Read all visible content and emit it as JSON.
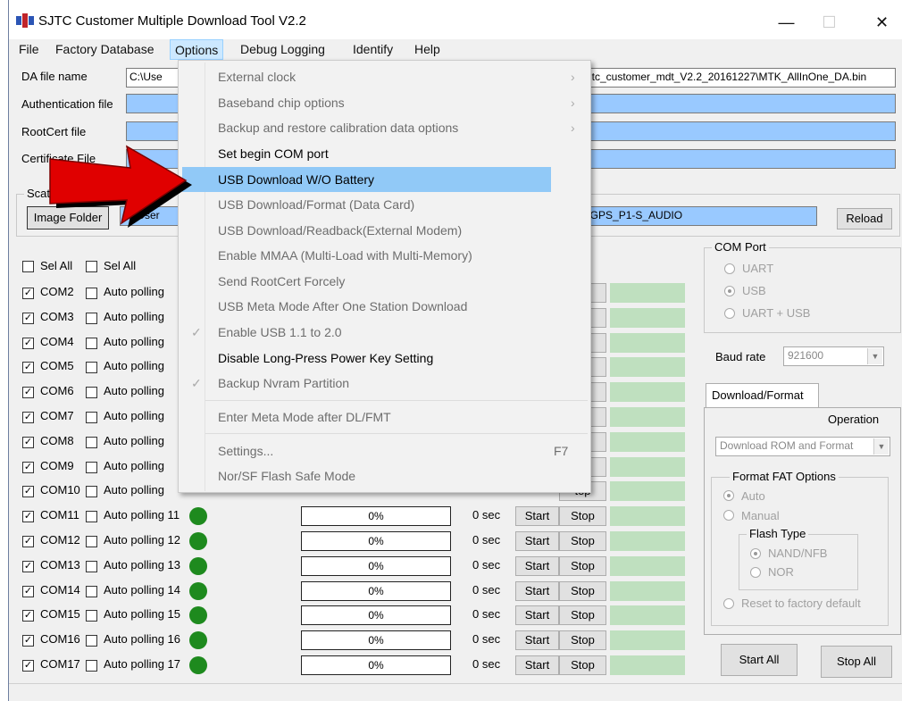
{
  "window": {
    "title": "SJTC Customer Multiple Download Tool V2.2",
    "minimize": "—",
    "maximize": "☐",
    "close": "✕"
  },
  "menubar": [
    "File",
    "Factory Database",
    "Options",
    "Debug Logging",
    "Identify",
    "Help"
  ],
  "files": {
    "da_label": "DA file name",
    "da_value_left": "C:\\Use",
    "da_value_right": "sjtc_customer_mdt_V2.2_20161227\\MTK_AllInOne_DA.bin",
    "auth_label": "Authentication file",
    "rootcert_label": "RootCert file",
    "certificate_label": "Certificate File",
    "scatter_label": "Scatter",
    "image_folder_button": "Image Folder",
    "scatter_value_left": "C:\\User",
    "scatter_value_right": "_GPS_P1-S_AUDIO",
    "reload_button": "Reload"
  },
  "select_all": [
    "Sel All",
    "Sel All"
  ],
  "ports": [
    {
      "name": "COM2",
      "polling": "Auto polling"
    },
    {
      "name": "COM3",
      "polling": "Auto polling"
    },
    {
      "name": "COM4",
      "polling": "Auto polling"
    },
    {
      "name": "COM5",
      "polling": "Auto polling"
    },
    {
      "name": "COM6",
      "polling": "Auto polling"
    },
    {
      "name": "COM7",
      "polling": "Auto polling"
    },
    {
      "name": "COM8",
      "polling": "Auto polling"
    },
    {
      "name": "COM9",
      "polling": "Auto polling"
    },
    {
      "name": "COM10",
      "polling": "Auto polling"
    },
    {
      "name": "COM11",
      "polling": "Auto polling 11",
      "progress": "0%",
      "time": "0 sec"
    },
    {
      "name": "COM12",
      "polling": "Auto polling 12",
      "progress": "0%",
      "time": "0 sec"
    },
    {
      "name": "COM13",
      "polling": "Auto polling 13",
      "progress": "0%",
      "time": "0 sec"
    },
    {
      "name": "COM14",
      "polling": "Auto polling 14",
      "progress": "0%",
      "time": "0 sec"
    },
    {
      "name": "COM15",
      "polling": "Auto polling 15",
      "progress": "0%",
      "time": "0 sec"
    },
    {
      "name": "COM16",
      "polling": "Auto polling 16",
      "progress": "0%",
      "time": "0 sec"
    },
    {
      "name": "COM17",
      "polling": "Auto polling 17",
      "progress": "0%",
      "time": "0 sec"
    }
  ],
  "row_buttons": {
    "start": "Start",
    "stop": "Stop",
    "stop_partial": "top"
  },
  "com_port": {
    "title": "COM Port",
    "options": [
      "UART",
      "USB",
      "UART + USB"
    ],
    "selected": "USB"
  },
  "baud": {
    "label": "Baud rate",
    "value": "921600"
  },
  "download_tab": {
    "tab": "Download/Format",
    "operation_label": "Operation",
    "operation_value": "Download ROM and Format"
  },
  "format_fat": {
    "title": "Format FAT Options",
    "auto": "Auto",
    "manual": "Manual",
    "flash_type_title": "Flash  Type",
    "nand": "NAND/NFB",
    "nor": "NOR",
    "reset": "Reset to factory default"
  },
  "actions": {
    "start_all": "Start All",
    "stop_all": "Stop All"
  },
  "options_menu": [
    {
      "label": "External clock",
      "enabled": false,
      "submenu": true
    },
    {
      "label": "Baseband chip options",
      "enabled": false,
      "submenu": true
    },
    {
      "label": "Backup and restore calibration data options",
      "enabled": false,
      "submenu": true
    },
    {
      "label": "Set begin COM port",
      "enabled": true
    },
    {
      "label": "USB Download W/O Battery",
      "enabled": true,
      "highlighted": true
    },
    {
      "label": "USB Download/Format  (Data Card)",
      "enabled": false
    },
    {
      "label": "USB Download/Readback(External Modem)",
      "enabled": false
    },
    {
      "label": "Enable MMAA (Multi-Load with Multi-Memory)",
      "enabled": false
    },
    {
      "label": "Send RootCert Forcely",
      "enabled": false
    },
    {
      "label": "USB Meta Mode After One Station Download",
      "enabled": false
    },
    {
      "label": "Enable USB 1.1 to 2.0",
      "enabled": false,
      "checked": true
    },
    {
      "label": "Disable Long-Press Power Key Setting",
      "enabled": true
    },
    {
      "label": "Backup Nvram Partition",
      "enabled": false,
      "checked": true
    },
    {
      "label": "Enter Meta Mode after DL/FMT",
      "enabled": false
    },
    {
      "label": "Settings...",
      "enabled": false,
      "shortcut": "F7"
    },
    {
      "label": "Nor/SF Flash Safe Mode",
      "enabled": false
    }
  ],
  "colors": {
    "highlight": "#91c9f7",
    "field_blue": "#99c9ff",
    "status_green": "#1e8a1e",
    "arrow_red": "#e00000"
  }
}
